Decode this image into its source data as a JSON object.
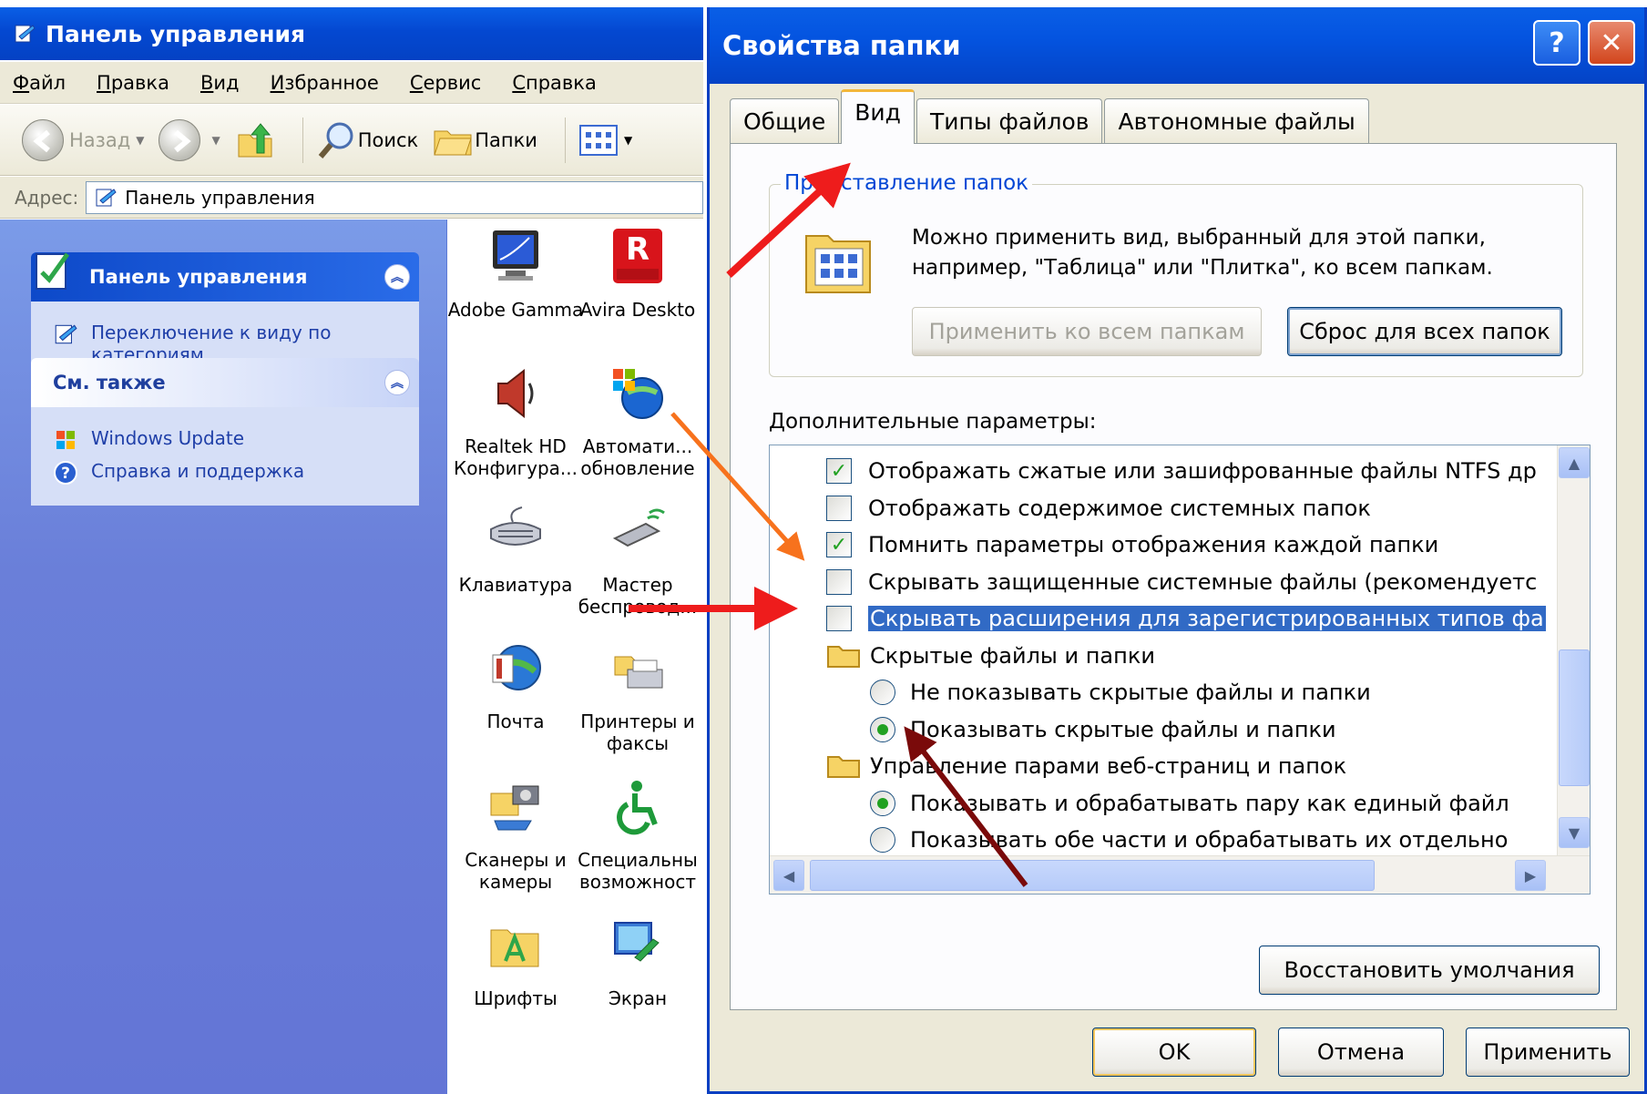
{
  "control_panel": {
    "title": "Панель управления",
    "menu": [
      "Файл",
      "Правка",
      "Вид",
      "Избранное",
      "Сервис",
      "Справка"
    ],
    "toolbar": {
      "back_label": "Назад",
      "search_label": "Поиск",
      "folders_label": "Папки"
    },
    "address": {
      "label": "Адрес:",
      "value": "Панель управления"
    },
    "sidebar": {
      "panel_title": "Панель управления",
      "switch_view_line1": "Переключение к виду по",
      "switch_view_line2": "категориям",
      "see_also_title": "См. также",
      "see_also_items": [
        "Windows Update",
        "Справка и поддержка"
      ]
    },
    "icons": [
      {
        "line1": "Adobe Gamma",
        "line2": ""
      },
      {
        "line1": "Avira Deskto",
        "line2": ""
      },
      {
        "line1": "Realtek HD",
        "line2": "Конфигура..."
      },
      {
        "line1": "Автомати...",
        "line2": "обновление"
      },
      {
        "line1": "Клавиатура",
        "line2": ""
      },
      {
        "line1": "Мастер",
        "line2": "беспровод..."
      },
      {
        "line1": "Почта",
        "line2": ""
      },
      {
        "line1": "Принтеры и",
        "line2": "факсы"
      },
      {
        "line1": "Сканеры и",
        "line2": "камеры"
      },
      {
        "line1": "Специальны",
        "line2": "возможност"
      },
      {
        "line1": "Шрифты",
        "line2": ""
      },
      {
        "line1": "Экран",
        "line2": ""
      }
    ]
  },
  "dialog": {
    "title": "Свойства папки",
    "help_glyph": "?",
    "close_glyph": "✕",
    "tabs": [
      "Общие",
      "Вид",
      "Типы файлов",
      "Автономные файлы"
    ],
    "active_tab": "Вид",
    "group_title": "Представление папок",
    "group_text": "Можно применить вид, выбранный для этой папки, например, \"Таблица\" или \"Плитка\", ко всем папкам.",
    "apply_all_button": "Применить ко всем папкам",
    "reset_all_button": "Сброс для всех папок",
    "advanced_label": "Дополнительные параметры:",
    "tree_items": [
      {
        "kind": "checkbox",
        "checked": true,
        "label": "Отображать сжатые или зашифрованные файлы NTFS др"
      },
      {
        "kind": "checkbox",
        "checked": false,
        "label": "Отображать содержимое системных папок"
      },
      {
        "kind": "checkbox",
        "checked": true,
        "label": "Помнить параметры отображения каждой папки"
      },
      {
        "kind": "checkbox",
        "checked": false,
        "label": "Скрывать защищенные системные файлы (рекомендуетс"
      },
      {
        "kind": "checkbox",
        "checked": false,
        "selected": true,
        "label": "Скрывать расширения для зарегистрированных типов фа"
      },
      {
        "kind": "folder",
        "label": "Скрытые файлы и папки"
      },
      {
        "kind": "radio",
        "checked": false,
        "label": "Не показывать скрытые файлы и папки"
      },
      {
        "kind": "radio",
        "checked": true,
        "label": "Показывать скрытые файлы и папки"
      },
      {
        "kind": "folder",
        "label": "Управление парами веб-страниц и папок"
      },
      {
        "kind": "radio",
        "checked": true,
        "label": "Показывать и обрабатывать пару как единый файл"
      },
      {
        "kind": "radio",
        "checked": false,
        "label": "Показывать обе части и обрабатывать их отдельно"
      }
    ],
    "restore_defaults_button": "Восстановить умолчания",
    "ok_button": "OK",
    "cancel_button": "Отмена",
    "apply_button": "Применить"
  },
  "annotation_colors": {
    "red": "#ee1c1c",
    "orange": "#f7721d",
    "dark_red": "#7a0a0a"
  }
}
